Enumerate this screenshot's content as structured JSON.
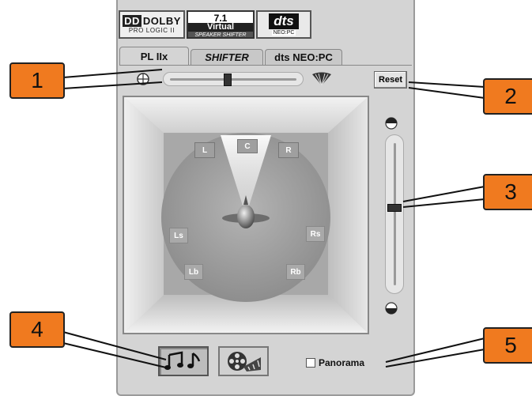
{
  "logos": {
    "dolby": {
      "brand": "DOLBY",
      "sub": "PRO LOGIC II"
    },
    "virtual": {
      "line1": "7.1",
      "line2": "Virtual",
      "line3": "SPEAKER SHIFTER"
    },
    "dts": {
      "brand": "dts",
      "sub": "NEO:PC"
    }
  },
  "tabs": [
    {
      "label": "PL IIx",
      "active": true
    },
    {
      "label": "SHIFTER",
      "active": false
    },
    {
      "label": "dts NEO:PC",
      "active": false
    }
  ],
  "balance_slider": {
    "value": 0.45
  },
  "reset_label": "Reset",
  "speakers": {
    "left": "L",
    "center": "C",
    "right": "R",
    "left_surround": "Ls",
    "right_surround": "Rs",
    "left_back": "Lb",
    "right_back": "Rb"
  },
  "volume_slider": {
    "value": 0.45
  },
  "panorama": {
    "label": "Panorama",
    "checked": false
  },
  "callouts": [
    "1",
    "2",
    "3",
    "4",
    "5"
  ],
  "colors": {
    "callout": "#f07a1f",
    "panel": "#d4d4d4",
    "room_floor": "#a5a5a5"
  }
}
